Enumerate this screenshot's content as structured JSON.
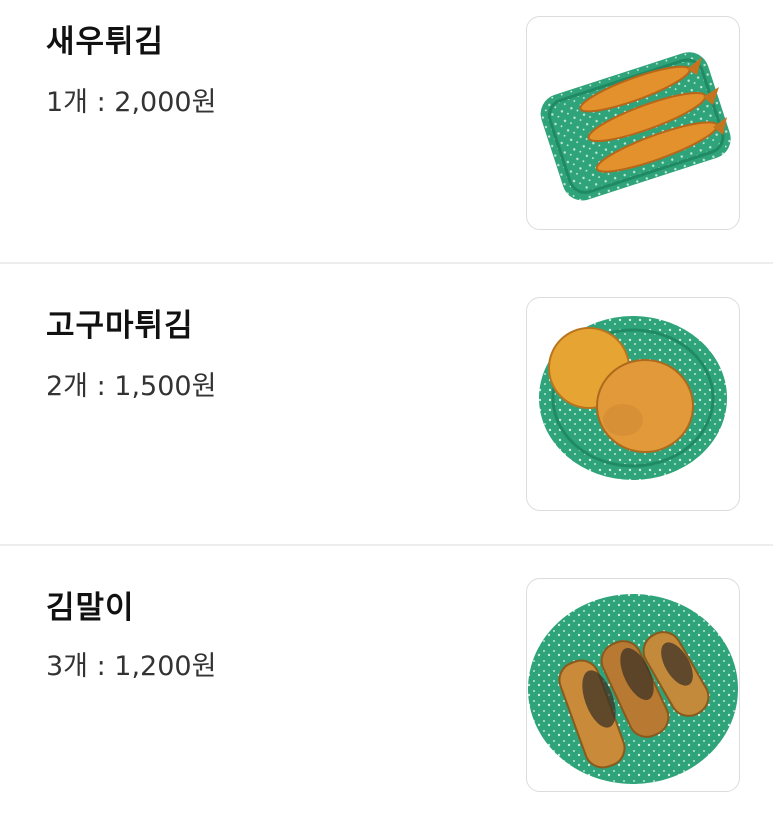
{
  "items": [
    {
      "name": "새우튀김",
      "price": "1개 : 2,000원",
      "image": "fried-shrimp-plate"
    },
    {
      "name": "고구마튀김",
      "price": "2개 : 1,500원",
      "image": "sweet-potato-fritter-plate"
    },
    {
      "name": "김말이",
      "price": "3개 : 1,200원",
      "image": "seaweed-roll-fritter-plate"
    }
  ],
  "colors": {
    "plate": "#2fa37a",
    "fried": "#e3912c",
    "divider": "#ededed"
  }
}
